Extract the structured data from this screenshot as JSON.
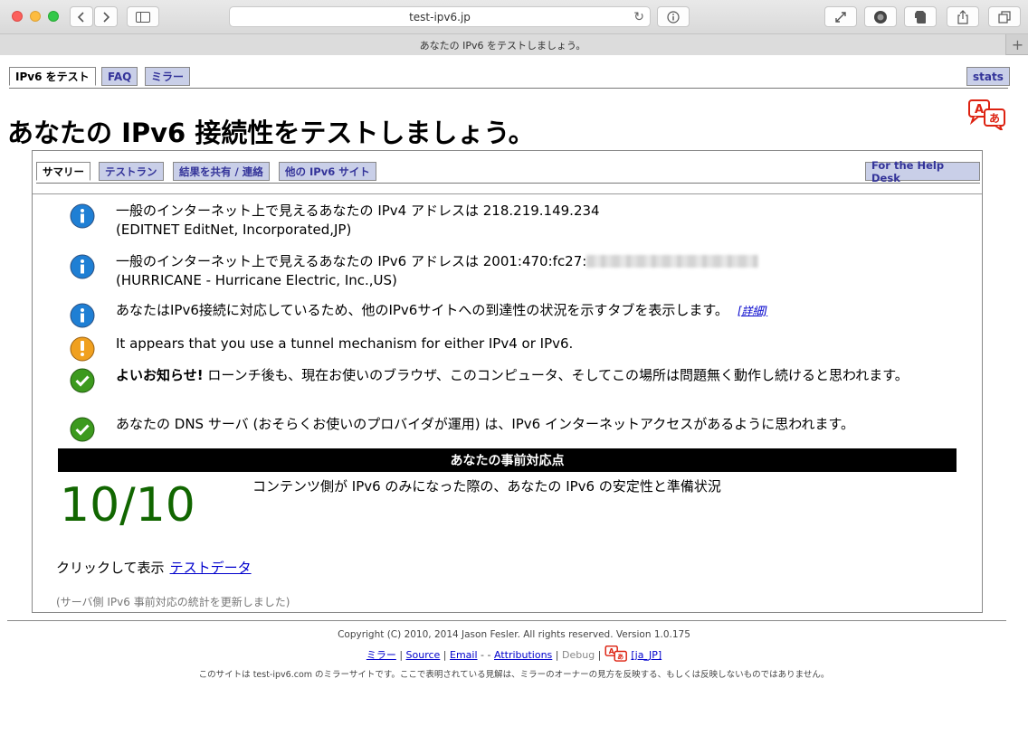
{
  "browser": {
    "url": "test-ipv6.jp",
    "tab_title": "あなたの IPv6 をテストしましょう。",
    "new_tab_label": "+"
  },
  "nav": {
    "tab_test": "IPv6 をテスト",
    "tab_faq": "FAQ",
    "tab_mirror": "ミラー",
    "tab_stats": "stats"
  },
  "page_title": "あなたの IPv6 接続性をテストしましょう。",
  "subnav": {
    "summary": "サマリー",
    "testrun": "テストラン",
    "share": "結果を共有 / 連絡",
    "other_sites": "他の IPv6 サイト",
    "helpdesk": "For the Help Desk"
  },
  "results": {
    "ipv4_line": "一般のインターネット上で見えるあなたの IPv4 アドレスは 218.219.149.234",
    "ipv4_isp": "(EDITNET EditNet, Incorporated,JP)",
    "ipv6_line": "一般のインターネット上で見えるあなたの IPv6 アドレスは 2001:470:fc27:",
    "ipv6_isp": "(HURRICANE - Hurricane Electric, Inc.,US)",
    "tabs_info": "あなたはIPv6接続に対応しているため、他のIPv6サイトへの到達性の状況を示すタブを表示します。",
    "tabs_info_link": "[詳細]",
    "tunnel": "It appears that you use a tunnel mechanism for either IPv4 or IPv6.",
    "good_news_bold": "よいお知らせ!",
    "good_news": " ローンチ後も、現在お使いのブラウザ、このコンピュータ、そしてこの場所は問題無く動作し続けると思われます。",
    "dns": "あなたの DNS サーバ (おそらくお使いのプロバイダが運用) は、IPv6 インターネットアクセスがあるように思われます。"
  },
  "readiness": {
    "header": "あなたの事前対応点",
    "score": "10/10",
    "description": "コンテンツ側が IPv6 のみになった際の、あなたの IPv6 の安定性と準備状況",
    "click_label": "クリックして表示",
    "test_data_link": "テストデータ",
    "stats_note": "(サーバ側 IPv6 事前対応の統計を更新しました)"
  },
  "footer": {
    "copyright": "Copyright (C) 2010, 2014 Jason Fesler. All rights reserved. Version 1.0.175",
    "link_mirror": "ミラー",
    "link_source": "Source",
    "link_email": "Email",
    "email_suffix": " -",
    "sep_dash": "-",
    "link_attributions": "Attributions",
    "link_debug": "Debug",
    "link_locale": "[ja_JP]",
    "mirror_note": "このサイトは test-ipv6.com のミラーサイトです。ここで表明されている見解は、ミラーのオーナーの見方を反映する、もしくは反映しないものではありません。"
  },
  "colors": {
    "tab_inactive_bg": "#c9cfe8",
    "tab_inactive_text": "#333399",
    "score_green": "#116600",
    "info_blue": "#1f7fd4",
    "warn_orange": "#f0a020",
    "ok_green": "#3c9a1e"
  }
}
